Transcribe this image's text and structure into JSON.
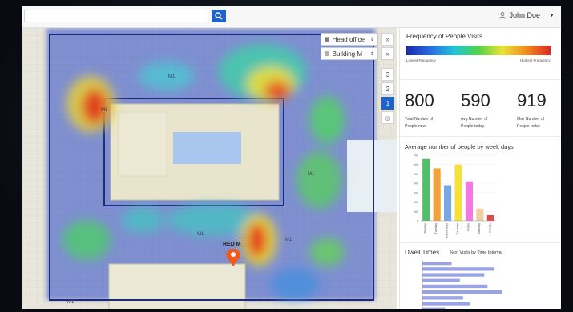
{
  "header": {
    "user_name": "John Doe",
    "search_placeholder": ""
  },
  "map": {
    "building_selector": "Head office",
    "floor_selector": "Building M",
    "floors": [
      "3",
      "2",
      "1"
    ],
    "active_floor": "1",
    "labels": {
      "m1": "M1",
      "m1_2": "M1",
      "m1_3": "M1",
      "m1_4": "M1",
      "m1_5": "M1",
      "m1_6": "M1",
      "red": "RED M"
    }
  },
  "panel": {
    "frequency_title": "Frequency of People Visits",
    "legend_low": "Lowest Frequency",
    "legend_high": "Highest Frequency",
    "stats": [
      {
        "value": "800",
        "label": "Total Number of People now"
      },
      {
        "value": "590",
        "label": "Avg Number of People today"
      },
      {
        "value": "919",
        "label": "Max Number of People today"
      }
    ],
    "weekdays_title": "Average number of people by week days",
    "dwell_title": "Dwell Times",
    "dwell_subtitle": "% of Visits by Time Interval"
  },
  "chart_data": [
    {
      "type": "bar",
      "title": "Average number of people by week days",
      "categories": [
        "Monday",
        "Tuesday",
        "Wednesday",
        "Thursday",
        "Friday",
        "Saturday",
        "Sunday"
      ],
      "values": [
        660,
        560,
        380,
        600,
        420,
        130,
        60
      ],
      "ylim": [
        0,
        700
      ],
      "yticks": [
        700,
        600,
        500,
        400,
        300,
        200,
        100,
        0
      ],
      "colors": [
        "#4fbf6a",
        "#f2a23a",
        "#7aa8e6",
        "#f5e13c",
        "#f07ae0",
        "#f0d0a0",
        "#e24a4a",
        "#40b6e8"
      ]
    },
    {
      "type": "bar",
      "orientation": "horizontal",
      "title": "Dwell Times",
      "subtitle": "% of Visits by Time Interval",
      "values": [
        18,
        44,
        38,
        23,
        40,
        49,
        25,
        29,
        14
      ],
      "xlim": [
        0,
        60
      ],
      "color": "#9aa4e4"
    }
  ]
}
